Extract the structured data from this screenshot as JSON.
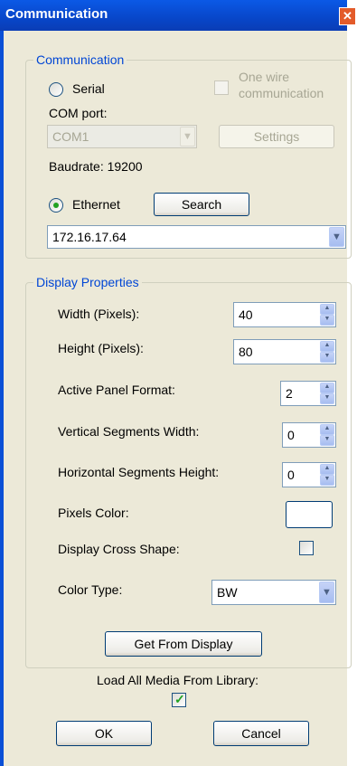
{
  "window": {
    "title": "Communication",
    "close_glyph": "✕"
  },
  "communication": {
    "legend": "Communication",
    "serial_label": "Serial",
    "one_wire_label_line1": "One wire",
    "one_wire_label_line2": "communication",
    "com_port_label": "COM port:",
    "com_port_value": "COM1",
    "settings_label": "Settings",
    "baudrate_text": "Baudrate: 19200",
    "ethernet_label": "Ethernet",
    "search_label": "Search",
    "ip_value": "172.16.17.64",
    "selected_mode": "Ethernet"
  },
  "display": {
    "legend": "Display Properties",
    "width_label": "Width (Pixels):",
    "width_value": "40",
    "height_label": "Height (Pixels):",
    "height_value": "80",
    "panel_format_label": "Active Panel Format:",
    "panel_format_value": "2",
    "vertical_label": "Vertical Segments Width:",
    "vertical_value": "0",
    "horizontal_label": "Horizontal Segments Height:",
    "horizontal_value": "0",
    "pixels_color_label": "Pixels Color:",
    "pixels_color": "#ffffff",
    "cross_label": "Display Cross Shape:",
    "cross_checked": false,
    "color_type_label": "Color Type:",
    "color_type_value": "BW",
    "get_from_display_label": "Get From Display"
  },
  "load_all_media_label": "Load All Media From Library:",
  "load_all_media_checked": true,
  "ok_label": "OK",
  "cancel_label": "Cancel",
  "icons": {
    "dropdown": "chevron-down-icon",
    "spin": "spin-arrows-icon",
    "check": "checkmark-icon",
    "close": "close-icon"
  },
  "colors": {
    "title_bar": "#0a4fd6",
    "dialog_bg": "#ece9d8",
    "legend_text": "#0046d5",
    "check_green": "#21a121"
  }
}
